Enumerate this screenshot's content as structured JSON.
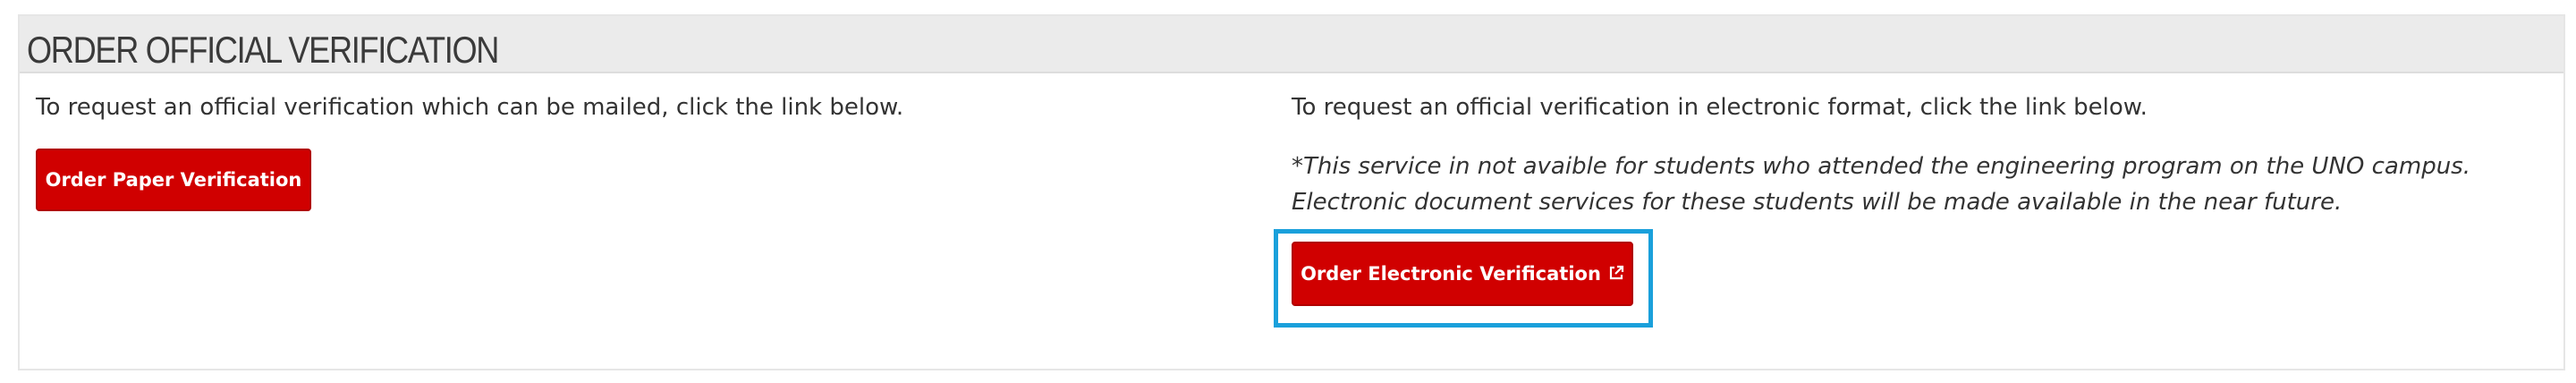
{
  "section": {
    "title": "ORDER OFFICIAL VERIFICATION"
  },
  "left_column": {
    "instruction": "To request an official verification which can be mailed, click the link below.",
    "button_label": "Order Paper Verification"
  },
  "right_column": {
    "instruction": "To request an official verification in electronic format, click the link below.",
    "note_line1": "*This service in not avaible for students who attended the engineering program on the UNO campus.",
    "note_line2": "Electronic document services for these students will be made available in the near future.",
    "button_label": "Order Electronic Verification",
    "button_icon": "external-link-icon"
  },
  "colors": {
    "button_red": "#d00000",
    "highlight_blue": "#1aa0db",
    "header_gray": "#ebebeb"
  }
}
